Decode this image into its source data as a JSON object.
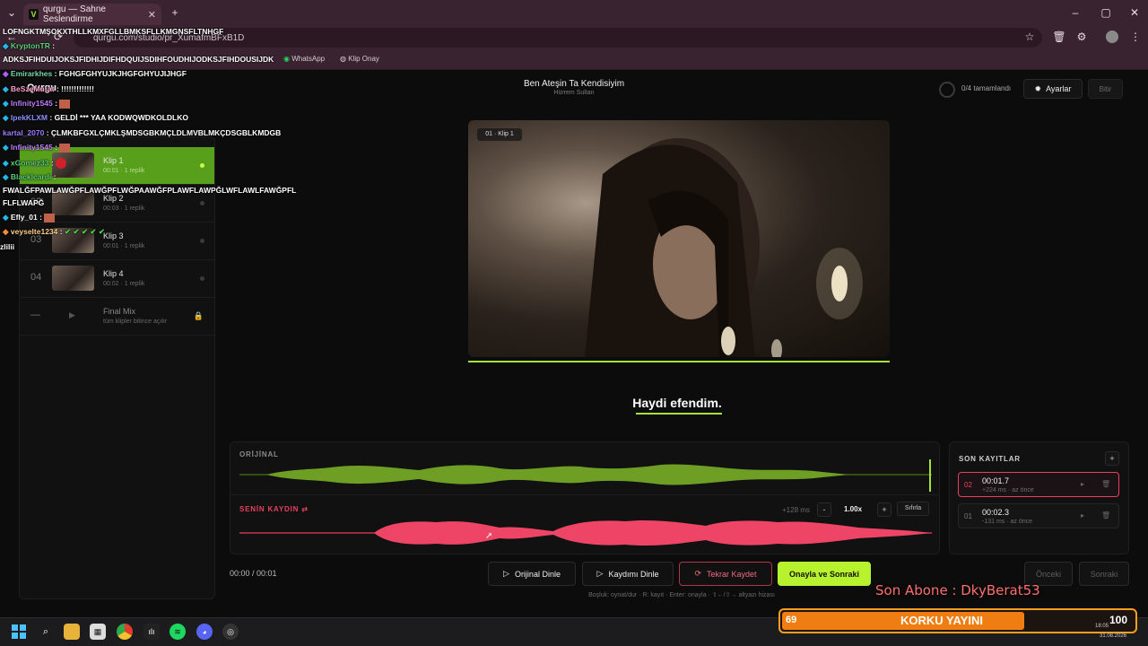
{
  "browser": {
    "tab_title": "qurgu — Sahne Seslendirme",
    "tab_favicon": "V",
    "url": "qurgu.com/studio/pr_XumafmBFxB1D",
    "bookmarks": [
      "WhatsApp",
      "Klip Onay"
    ]
  },
  "app": {
    "logo": "Qurgu",
    "scene_title": "Ben Ateşin Ta Kendisiyim",
    "scene_subtitle": "Hürrem Sultan",
    "progress": "0/4 tamamlandı",
    "settings_label": "Ayarlar",
    "finish_label": "Bitir"
  },
  "clips": [
    {
      "num": "01",
      "name": "Klip 1",
      "meta": "00:01 · 1 replik",
      "active": true
    },
    {
      "num": "02",
      "name": "Klip 2",
      "meta": "00:03 · 1 replik",
      "active": false
    },
    {
      "num": "03",
      "name": "Klip 3",
      "meta": "00:01 · 1 replik",
      "active": false
    },
    {
      "num": "04",
      "name": "Klip 4",
      "meta": "00:02 · 1 replik",
      "active": false
    }
  ],
  "final_mix": {
    "num": "—",
    "name": "Final Mix",
    "meta": "tüm klipler bitince açılır"
  },
  "video": {
    "label": "01 · Klip 1",
    "subtitle": "Haydi efendim."
  },
  "wave": {
    "original_label": "ORİJİNAL",
    "recording_label": "SENİN KAYDIN ⇄",
    "offset": "+128 ms",
    "minus": "-",
    "speed": "1.00x",
    "plus": "+",
    "reset": "Sıfırla"
  },
  "recordings": {
    "title": "SON KAYITLAR",
    "add": "+",
    "items": [
      {
        "num": "02",
        "time": "00:01.7",
        "meta": "+224 ms · az önce",
        "selected": true
      },
      {
        "num": "01",
        "time": "00:02.3",
        "meta": "-131 ms · az önce",
        "selected": false
      }
    ]
  },
  "controls": {
    "time": "00:00 / 00:01",
    "play_original": "Orijinal Dinle",
    "play_mine": "Kaydımı Dinle",
    "rerecord": "Tekrar Kaydet",
    "approve": "Onayla ve Sonraki",
    "prev": "Önceki",
    "next": "Sonraki",
    "hint": "Boşluk: oynat/dur · R: kayıt · Enter: onayla · ⇧←/⇧→ altyazı hizası"
  },
  "stream": {
    "chat": [
      {
        "user": "",
        "msg": "LOFNGKTMŞOKXTHLLKMXFGLLBMKSFLLKMGNSFLTNHGF"
      },
      {
        "user": "KryptonTR",
        "msg": ":"
      },
      {
        "user": "",
        "msg": "ADKSJFIHDUIJOKSJFIDHIJDIFHDQUIJSDIHFOUDHIJODKSJFIHDOUSIJDK"
      },
      {
        "user": "Emirarkhes",
        "msg": ": FGHGFGHYUJKJHGFGHYUJIJHGF"
      },
      {
        "user": "BeSzeMurat",
        "msg": ": !!!!!!!!!!!!!"
      },
      {
        "user": "Infinity1545",
        "msg": ":"
      },
      {
        "user": "IpekKLXM",
        "msg": ": GELDİ *** YAA KODWQWDKOLDLKO"
      },
      {
        "user": "kartal_2070",
        "msg": ": ÇLMKBFGXLÇMKLŞMDSGBKMÇLDLMVBLMKÇDSGBLKMDGB"
      },
      {
        "user": "Infinity1545",
        "msg": ":"
      },
      {
        "user": "xGomez33",
        "msg": ":"
      },
      {
        "user": "Blacklcardi",
        "msg": ":"
      },
      {
        "user": "",
        "msg": "FWALĞFPAWLAWĞPFLAWĞPFLWĞPAAWĞFPLAWFLAWPĞLWFLAWLFAWĞPFL"
      },
      {
        "user": "",
        "msg": "FLFLWAPĞ"
      },
      {
        "user": "Efly_01",
        "msg": ":"
      },
      {
        "user": "veyselte1234",
        "msg": ":"
      },
      {
        "user": "",
        "msg": "zlilii"
      }
    ],
    "last_subscriber": "Son Abone : DkyBerat53",
    "goal_label": "KORKU YAYINI",
    "goal_current": "69",
    "goal_target": "100",
    "goal_progress": 0.69
  },
  "taskbar": {
    "time": "18:05",
    "date": "31.08.2026"
  },
  "colors": {
    "accent_green": "#a6e33a",
    "record_red": "#e7405e",
    "browser_frame": "#3a2330",
    "goal_orange": "#f07d12"
  }
}
